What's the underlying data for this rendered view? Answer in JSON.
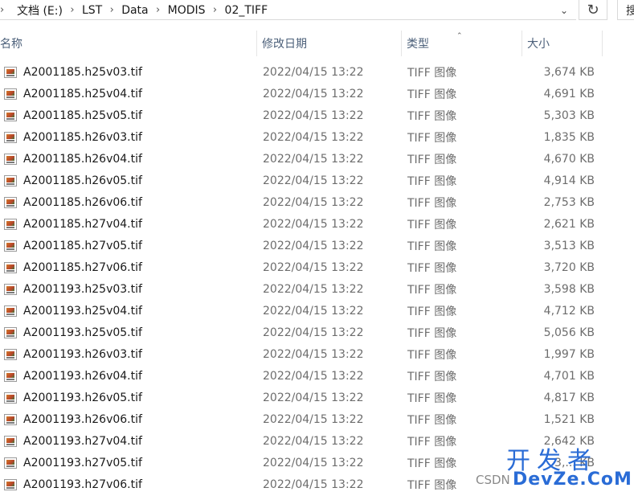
{
  "breadcrumb": {
    "lead": "...",
    "parts": [
      "文档 (E:)",
      "LST",
      "Data",
      "MODIS",
      "02_TIFF"
    ]
  },
  "toolbar": {
    "dropdown_icon": "chevron-down-icon",
    "refresh_icon": "refresh-icon",
    "search_partial": "搜"
  },
  "columns": {
    "name": "名称",
    "date": "修改日期",
    "type": "类型",
    "size": "大小"
  },
  "files": [
    {
      "name": "A2001185.h25v03.tif",
      "date": "2022/04/15 13:22",
      "type": "TIFF 图像",
      "size": "3,674 KB"
    },
    {
      "name": "A2001185.h25v04.tif",
      "date": "2022/04/15 13:22",
      "type": "TIFF 图像",
      "size": "4,691 KB"
    },
    {
      "name": "A2001185.h25v05.tif",
      "date": "2022/04/15 13:22",
      "type": "TIFF 图像",
      "size": "5,303 KB"
    },
    {
      "name": "A2001185.h26v03.tif",
      "date": "2022/04/15 13:22",
      "type": "TIFF 图像",
      "size": "1,835 KB"
    },
    {
      "name": "A2001185.h26v04.tif",
      "date": "2022/04/15 13:22",
      "type": "TIFF 图像",
      "size": "4,670 KB"
    },
    {
      "name": "A2001185.h26v05.tif",
      "date": "2022/04/15 13:22",
      "type": "TIFF 图像",
      "size": "4,914 KB"
    },
    {
      "name": "A2001185.h26v06.tif",
      "date": "2022/04/15 13:22",
      "type": "TIFF 图像",
      "size": "2,753 KB"
    },
    {
      "name": "A2001185.h27v04.tif",
      "date": "2022/04/15 13:22",
      "type": "TIFF 图像",
      "size": "2,621 KB"
    },
    {
      "name": "A2001185.h27v05.tif",
      "date": "2022/04/15 13:22",
      "type": "TIFF 图像",
      "size": "3,513 KB"
    },
    {
      "name": "A2001185.h27v06.tif",
      "date": "2022/04/15 13:22",
      "type": "TIFF 图像",
      "size": "3,720 KB"
    },
    {
      "name": "A2001193.h25v03.tif",
      "date": "2022/04/15 13:22",
      "type": "TIFF 图像",
      "size": "3,598 KB"
    },
    {
      "name": "A2001193.h25v04.tif",
      "date": "2022/04/15 13:22",
      "type": "TIFF 图像",
      "size": "4,712 KB"
    },
    {
      "name": "A2001193.h25v05.tif",
      "date": "2022/04/15 13:22",
      "type": "TIFF 图像",
      "size": "5,056 KB"
    },
    {
      "name": "A2001193.h26v03.tif",
      "date": "2022/04/15 13:22",
      "type": "TIFF 图像",
      "size": "1,997 KB"
    },
    {
      "name": "A2001193.h26v04.tif",
      "date": "2022/04/15 13:22",
      "type": "TIFF 图像",
      "size": "4,701 KB"
    },
    {
      "name": "A2001193.h26v05.tif",
      "date": "2022/04/15 13:22",
      "type": "TIFF 图像",
      "size": "4,817 KB"
    },
    {
      "name": "A2001193.h26v06.tif",
      "date": "2022/04/15 13:22",
      "type": "TIFF 图像",
      "size": "1,521 KB"
    },
    {
      "name": "A2001193.h27v04.tif",
      "date": "2022/04/15 13:22",
      "type": "TIFF 图像",
      "size": "2,642 KB"
    },
    {
      "name": "A2001193.h27v05.tif",
      "date": "2022/04/15 13:22",
      "type": "TIFF 图像",
      "size": "3,... KB"
    },
    {
      "name": "A2001193.h27v06.tif",
      "date": "2022/04/15 13:22",
      "type": "TIFF 图像",
      "size": ""
    }
  ],
  "watermark": {
    "big": "开发者",
    "small": "CSDN",
    "domain": "DevZe.CoM"
  }
}
